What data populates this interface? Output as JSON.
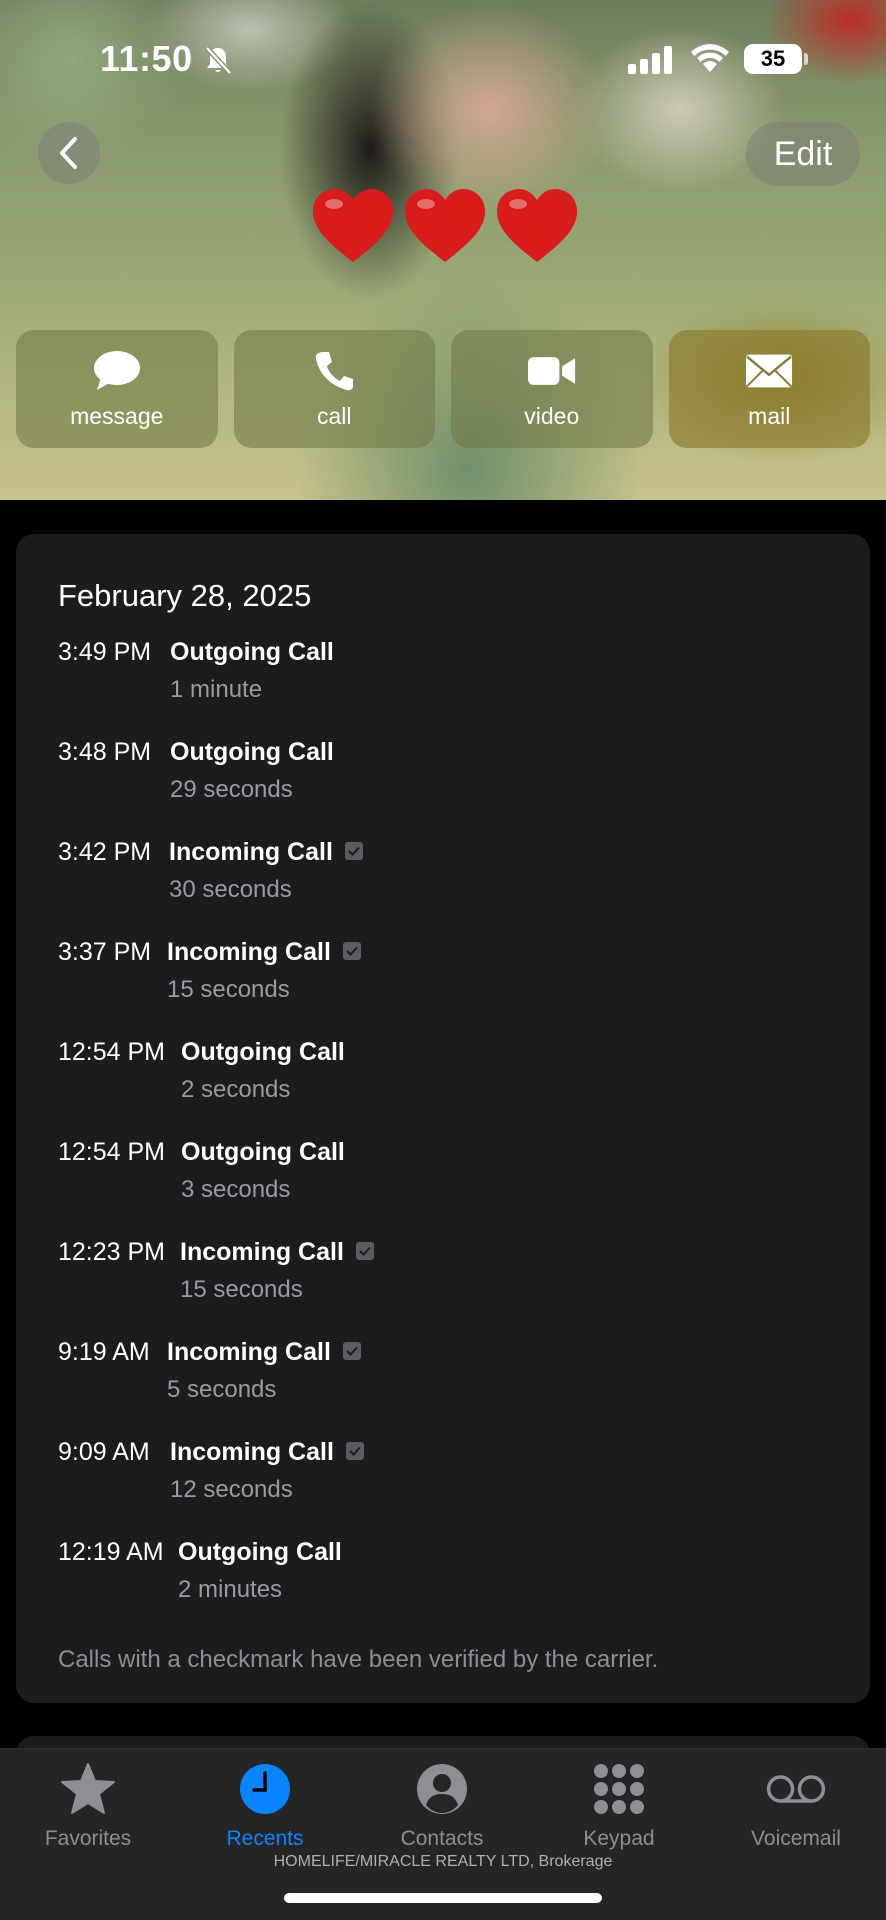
{
  "status_bar": {
    "time": "11:50",
    "battery": "35",
    "icons": [
      "bell-slash-icon",
      "signal-icon",
      "wifi-icon",
      "battery-icon"
    ]
  },
  "header": {
    "back_icon": "chevron-left-icon",
    "edit_label": "Edit",
    "hearts": [
      "❤️",
      "❤️",
      "❤️"
    ],
    "actions": [
      {
        "label": "message",
        "icon": "message-bubble-icon"
      },
      {
        "label": "call",
        "icon": "phone-icon"
      },
      {
        "label": "video",
        "icon": "video-camera-icon"
      },
      {
        "label": "mail",
        "icon": "envelope-icon"
      }
    ]
  },
  "call_log": {
    "date": "February 28, 2025",
    "calls": [
      {
        "time": "3:49 PM",
        "type": "Outgoing Call",
        "duration": "1 minute",
        "verified": false
      },
      {
        "time": "3:48 PM",
        "type": "Outgoing Call",
        "duration": "29 seconds",
        "verified": false
      },
      {
        "time": "3:42 PM",
        "type": "Incoming Call",
        "duration": "30 seconds",
        "verified": true
      },
      {
        "time": "3:37 PM",
        "type": "Incoming Call",
        "duration": "15 seconds",
        "verified": true
      },
      {
        "time": "12:54 PM",
        "type": "Outgoing Call",
        "duration": "2 seconds",
        "verified": false
      },
      {
        "time": "12:54 PM",
        "type": "Outgoing Call",
        "duration": "3 seconds",
        "verified": false
      },
      {
        "time": "12:23 PM",
        "type": "Incoming Call",
        "duration": "15 seconds",
        "verified": true
      },
      {
        "time": "9:19 AM",
        "type": "Incoming Call",
        "duration": "5 seconds",
        "verified": true
      },
      {
        "time": "9:09 AM",
        "type": "Incoming Call",
        "duration": "12 seconds",
        "verified": true
      },
      {
        "time": "12:19 AM",
        "type": "Outgoing Call",
        "duration": "2 minutes",
        "verified": false
      }
    ],
    "footnote": "Calls with a checkmark have been verified by the carrier."
  },
  "tab_bar": {
    "tabs": [
      {
        "label": "Favorites",
        "icon": "star-icon",
        "active": false
      },
      {
        "label": "Recents",
        "icon": "clock-icon",
        "active": true
      },
      {
        "label": "Contacts",
        "icon": "person-circle-icon",
        "active": false
      },
      {
        "label": "Keypad",
        "icon": "keypad-icon",
        "active": false
      },
      {
        "label": "Voicemail",
        "icon": "voicemail-icon",
        "active": false
      }
    ],
    "watermark": "HOMELIFE/MIRACLE REALTY LTD, Brokerage"
  },
  "colors": {
    "accent": "#0a84ff",
    "card_bg": "#1c1c1e",
    "secondary_text": "#9a9aa0",
    "heart": "#d81c1c"
  }
}
